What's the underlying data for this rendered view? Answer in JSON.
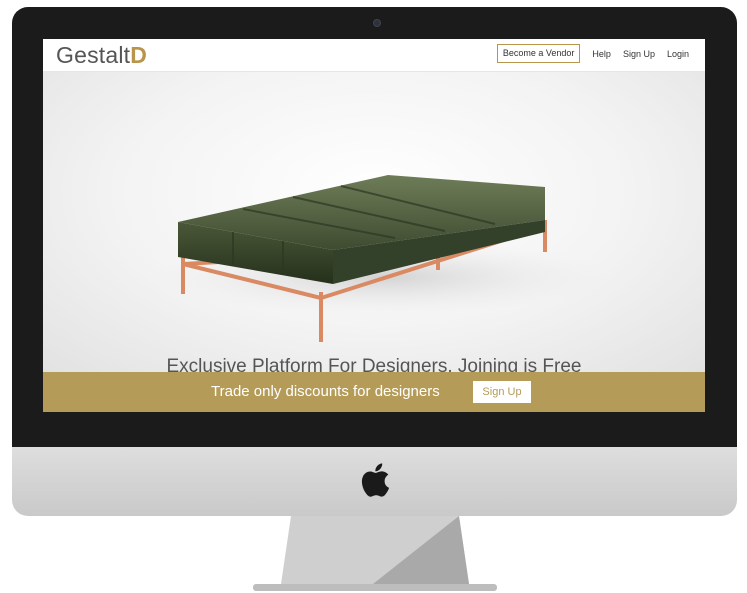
{
  "brand": {
    "logo_text": "Gestalt",
    "logo_accent": "D",
    "accent_color": "#b8954a"
  },
  "nav": {
    "become_vendor": "Become a Vendor",
    "help": "Help",
    "sign_up": "Sign Up",
    "login": "Login"
  },
  "hero": {
    "tagline": "Exclusive Platform For Designers. Joining is Free"
  },
  "promo": {
    "text": "Trade only discounts for designers",
    "button": "Sign Up",
    "band_color": "#b59b58"
  },
  "device": {
    "stand_icon": "apple-logo-icon"
  }
}
